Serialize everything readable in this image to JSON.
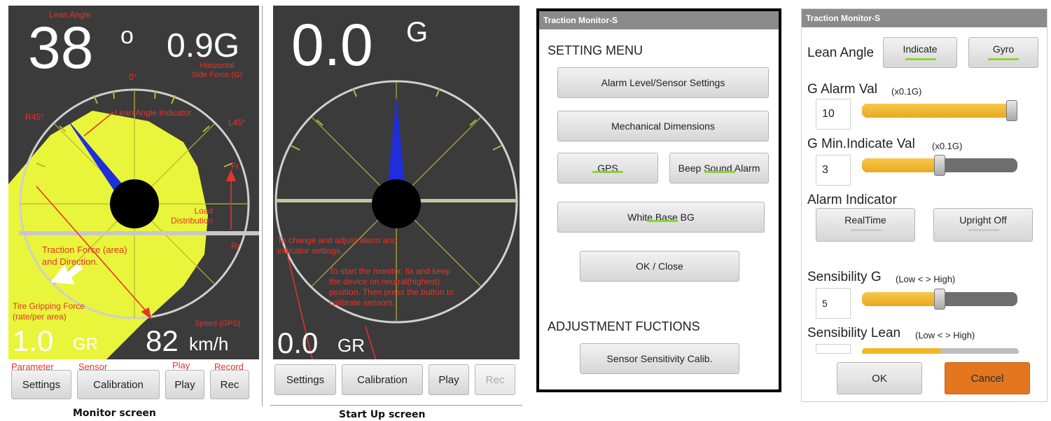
{
  "monitor": {
    "lean_angle_caption": "Lean Angle",
    "lean_value": "38",
    "degree_sign": "o",
    "g_value": "0.9G",
    "horizontal_side_force": [
      "Horizontal",
      "Side Force (G)"
    ],
    "zero_label": "0°",
    "r45_label": "R45°",
    "l45_label": "L45°",
    "lean_indicator_caption": "Lean Angle Indicator",
    "fr_label": "Fr",
    "rr_label": "Rr",
    "load_distribution": [
      "Load",
      "Distribution"
    ],
    "traction_force": [
      "Traction Force (area)",
      "and Direction."
    ],
    "tire_gripping": [
      "Tire Gripping Force",
      "(rate/per area)"
    ],
    "speed_caption": "Speed (GPS)",
    "gr_value": "1.0",
    "gr_unit": "GR",
    "speed_value": "82",
    "speed_unit": "km/h",
    "button_captions": [
      "Parameter",
      "Sensor",
      "Play",
      "Record"
    ],
    "buttons": [
      "Settings",
      "Calibration",
      "Play",
      "Rec"
    ],
    "screen_caption": "Monitor screen",
    "colors": {
      "background": "#3b3b3b",
      "traction_area": "#e9f53a",
      "needle": "#1f2ed8",
      "annotation": "#e8332a"
    }
  },
  "startup": {
    "g_value": "0.0",
    "g_unit": "G",
    "note1": [
      "To change and adjust alarm and",
      "indicator settings."
    ],
    "note2": [
      "To start the monitor, fix and keep",
      "the device on neutral(highest)",
      "position. Then press the button to",
      "calibrate sensors."
    ],
    "gr_value": "0.0",
    "gr_unit": "GR",
    "buttons": [
      "Settings",
      "Calibration",
      "Play",
      "Rec"
    ],
    "screen_caption": "Start Up screen"
  },
  "setting_menu": {
    "app_title": "Traction Monitor-S",
    "heading": "SETTING MENU",
    "alarm_button": "Alarm Level/Sensor Settings",
    "mechanical_button": "Mechanical Dimensions",
    "gps_button": "GPS",
    "beep_button": "Beep Sound Alarm",
    "white_bg_button": "White Base BG",
    "ok_button": "OK / Close",
    "adjust_heading": "ADJUSTMENT FUCTIONS",
    "sensitivity_button": "Sensor Sensitivity Calib."
  },
  "alarm_settings": {
    "app_title": "Traction Monitor-S",
    "lean_angle_label": "Lean Angle",
    "indicate_button": "Indicate",
    "gyro_button": "Gyro",
    "g_alarm_label": "G Alarm Val",
    "g_alarm_unit": "(x0.1G)",
    "g_alarm_value": "10",
    "g_alarm_level": 1.0,
    "g_min_label": "G Min.Indicate Val",
    "g_min_unit": "(x0.1G)",
    "g_min_value": "3",
    "g_min_level": 0.5,
    "alarm_indicator_label": "Alarm Indicator",
    "realtime_button": "RealTime",
    "upright_button": "Upright Off",
    "sens_g_label": "Sensibility G",
    "sens_g_range": "(Low < > High)",
    "sens_g_value": "5",
    "sens_g_level": 0.5,
    "sens_lean_label": "Sensibility Lean",
    "sens_lean_range": "(Low < > High)",
    "ok_button": "OK",
    "cancel_button": "Cancel",
    "colors": {
      "cancel": "#e3761f",
      "slider_fill": "#f0b829",
      "toggle_on": "#8fd13a"
    }
  }
}
